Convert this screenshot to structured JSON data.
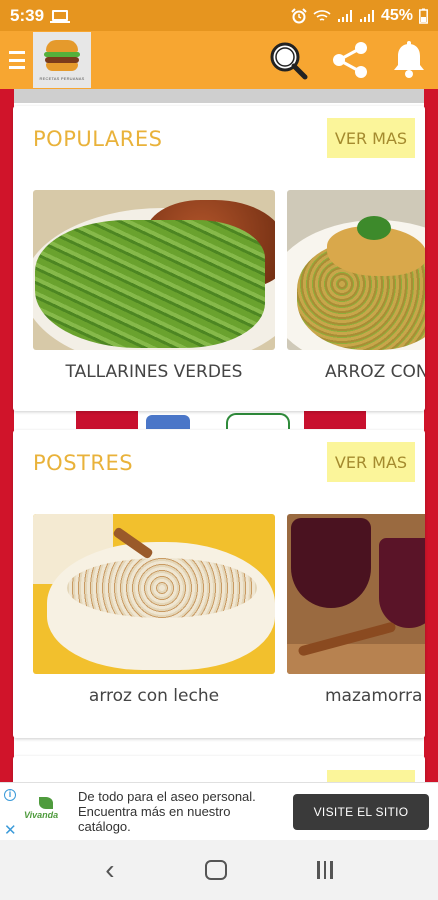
{
  "status_bar": {
    "time": "5:39",
    "battery": "45%",
    "icons": [
      "screen-cast-icon",
      "alarm-icon",
      "wifi-icon",
      "signal-icon",
      "signal-icon"
    ]
  },
  "app_bar": {
    "logo_caption": "RECETAS PERUANAS",
    "icons": [
      "menu-icon",
      "search-icon",
      "share-icon",
      "bell-icon"
    ],
    "accent_color": "#f7a631",
    "status_color": "#e6951f"
  },
  "sections": [
    {
      "title": "POPULARES",
      "action": "VER MAS",
      "items": [
        {
          "label": "TALLARINES VERDES"
        },
        {
          "label": "ARROZ CON"
        }
      ]
    },
    {
      "title": "POSTRES",
      "action": "VER MAS",
      "items": [
        {
          "label": "arroz con leche"
        },
        {
          "label": "mazamorra"
        }
      ]
    }
  ],
  "ad": {
    "brand": "Vivanda",
    "text": "De todo para el aseo personal. Encuentra más en nuestro catálogo.",
    "button": "VISITE EL SITIO",
    "icons": [
      "info-icon",
      "close-icon"
    ]
  },
  "nav_bar": {
    "icons": [
      "back-icon",
      "home-icon",
      "recents-icon"
    ]
  }
}
